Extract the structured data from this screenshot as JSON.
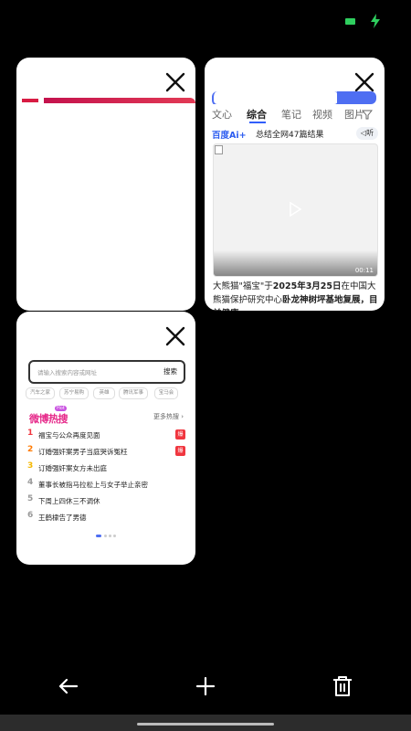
{
  "status_bar": {
    "battery_color": "#2fcf5f",
    "icons": [
      "battery-icon",
      "charging-icon"
    ]
  },
  "tabs": [
    {
      "id": "tab1",
      "close_icon": "close-icon"
    },
    {
      "id": "tab2",
      "nav_tabs": [
        "文心",
        "综合",
        "笔记",
        "视频",
        "图片"
      ],
      "active_tab": "综合",
      "ai_label": "百度Ai+",
      "ai_summary": "总结全网47篇结果",
      "listen_label": "听",
      "video_duration": "00:11",
      "summary_part1": "大熊猫\"福宝\"于",
      "summary_bold1": "2025年3月25日",
      "summary_part2": "在中国大熊猫保护研究中心",
      "summary_bold2": "卧龙神树坪基地复展，目前健康"
    },
    {
      "id": "tab3",
      "search_placeholder": "请输入搜索内容或网址",
      "search_button": "搜索",
      "chips": [
        "汽车之家",
        "苏宁易购",
        "英雄",
        "腾讯军事",
        "宝马会"
      ],
      "hot_title": "微博热搜",
      "hot_badge": "Hot",
      "more_label": "更多热搜",
      "hot_items": [
        {
          "rank": "1",
          "text": "福宝与公众再度见面",
          "tag": "爆",
          "color": "#f0363f"
        },
        {
          "rank": "2",
          "text": "订婚强奸案男子当庭哭诉冤枉",
          "tag": "爆",
          "color": "#ff7a00"
        },
        {
          "rank": "3",
          "text": "订婚强奸案女方未出庭",
          "tag": "",
          "color": "#f5b800"
        },
        {
          "rank": "4",
          "text": "董事长被指马拉松上与女子举止亲密",
          "tag": "",
          "color": "#999999"
        },
        {
          "rank": "5",
          "text": "下周上四休三不调休",
          "tag": "",
          "color": "#999999"
        },
        {
          "rank": "6",
          "text": "王鹤棣告了男德",
          "tag": "",
          "color": "#999999"
        }
      ]
    }
  ],
  "bottom_nav": {
    "icons": [
      "back-arrow-icon",
      "add-tab-icon",
      "delete-all-icon"
    ]
  }
}
